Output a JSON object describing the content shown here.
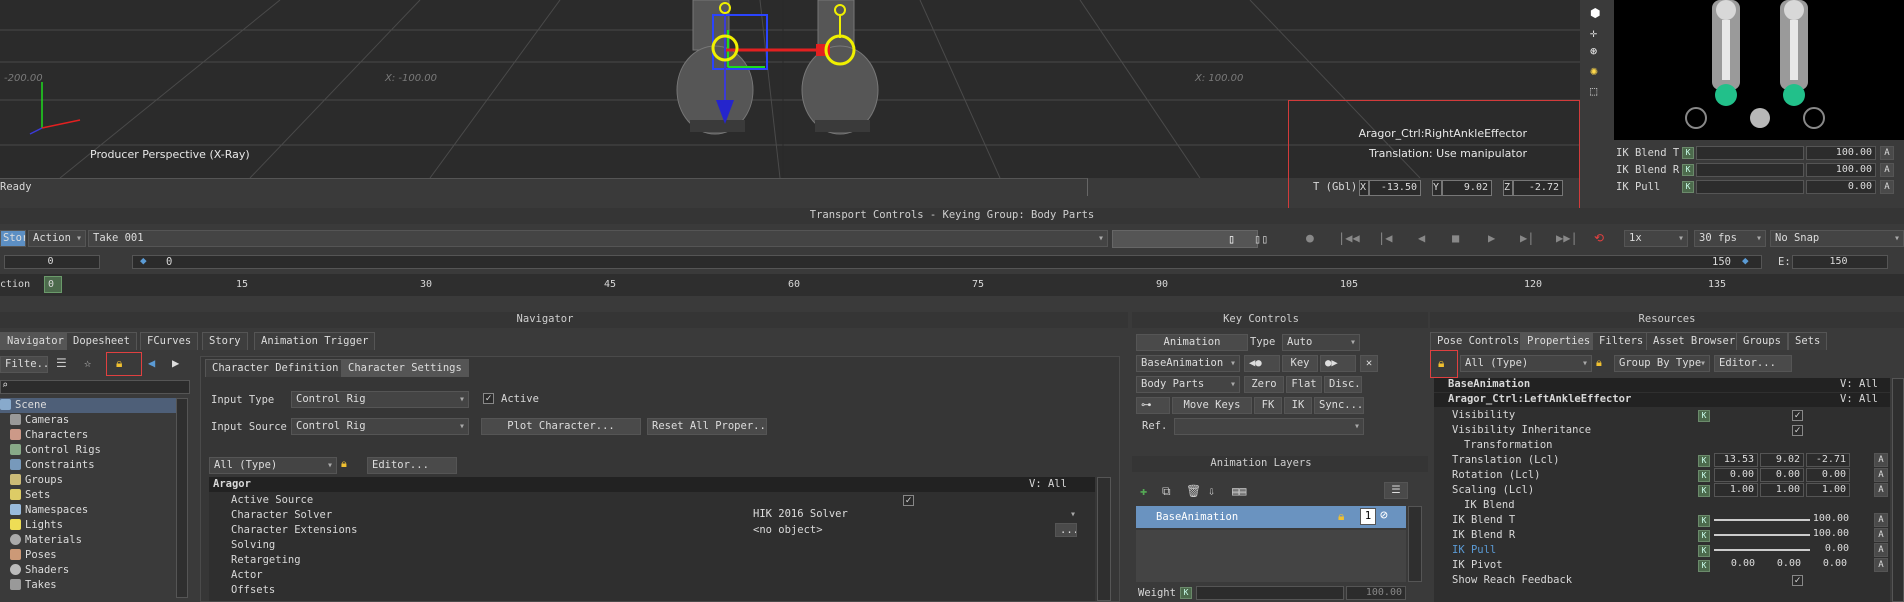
{
  "viewport": {
    "grid_labels": [
      "-200.00",
      "X: -100.00",
      "X: 100.00"
    ],
    "camera_label": "Producer Perspective (X-Ray)",
    "status": "Ready",
    "selection_name": "Aragor_Ctrl:RightAnkleEffector",
    "selection_mode": "Translation: Use manipulator",
    "coord_label": "T (Gbl)",
    "x_label": "X",
    "x_value": "-13.50",
    "y_label": "Y",
    "y_value": "9.02",
    "z_label": "Z",
    "z_value": "-2.72"
  },
  "ik_mini": {
    "rows": [
      {
        "label": "IK Blend T",
        "k": "K",
        "value": "100.00",
        "a": "A"
      },
      {
        "label": "IK Blend R",
        "k": "K",
        "value": "100.00",
        "a": "A"
      },
      {
        "label": "IK Pull",
        "k": "K",
        "value": "0.00",
        "a": "A"
      }
    ]
  },
  "transport": {
    "title": "Transport Controls  -  Keying Group: Body Parts",
    "story_btn": "Story",
    "action_combo": "Action",
    "take_combo": "Take 001",
    "speed": "1x",
    "fps": "30 fps",
    "snap": "No Snap",
    "start_frame": "0",
    "cur_frame": "0",
    "end_frame": "150",
    "end_label": "E:",
    "end_value": "150",
    "ruler_prefix": "ction",
    "ruler_marks": [
      "0",
      "15",
      "30",
      "45",
      "60",
      "75",
      "90",
      "105",
      "120",
      "135"
    ]
  },
  "navigator": {
    "title": "Navigator",
    "tabs": [
      "Navigator",
      "Dopesheet",
      "FCurves",
      "Story",
      "Animation Trigger"
    ],
    "filter_label": "Filte...",
    "tree": [
      "Scene",
      "Cameras",
      "Characters",
      "Control Rigs",
      "Constraints",
      "Groups",
      "Sets",
      "Namespaces",
      "Lights",
      "Materials",
      "Poses",
      "Shaders",
      "Takes"
    ],
    "char_tabs": [
      "Character Definition",
      "Character Settings"
    ],
    "input_type_label": "Input Type",
    "input_type_value": "Control Rig",
    "active_label": "Active",
    "input_source_label": "Input Source",
    "input_source_value": "Control Rig",
    "plot_btn": "Plot Character...",
    "reset_btn": "Reset All Proper...",
    "type_filter": "All (Type)",
    "editor_btn": "Editor...",
    "prop_header": "Aragor",
    "prop_header_v": "V: All",
    "props": [
      {
        "label": "Active Source",
        "value": ""
      },
      {
        "label": "Character Solver",
        "value": "HIK 2016 Solver"
      },
      {
        "label": "Character Extensions",
        "value": "<no object>"
      },
      {
        "label": "Solving",
        "value": ""
      },
      {
        "label": "Retargeting",
        "value": ""
      },
      {
        "label": "Actor",
        "value": ""
      },
      {
        "label": "Offsets",
        "value": ""
      }
    ]
  },
  "key_controls": {
    "title": "Key Controls",
    "animation_label": "Animation",
    "type_label": "Type",
    "type_value": "Auto",
    "layer_combo": "BaseAnimation",
    "key_btn": "Key",
    "group_combo": "Body Parts",
    "zero_btn": "Zero",
    "flat_btn": "Flat",
    "disc_btn": "Disc.",
    "move_keys_btn": "Move Keys",
    "fk_btn": "FK",
    "ik_btn": "IK",
    "sync_btn": "Sync...",
    "ref_label": "Ref."
  },
  "anim_layers": {
    "title": "Animation Layers",
    "layer_name": "BaseAnimation",
    "layer_num": "1",
    "weight_label": "Weight",
    "weight_k": "K",
    "weight_value": "100.00"
  },
  "resources": {
    "title": "Resources",
    "tabs": [
      "Pose Controls",
      "Properties",
      "Filters",
      "Asset Browser",
      "Groups",
      "Sets"
    ],
    "type_filter": "All (Type)",
    "group_by": "Group By Type",
    "editor_btn": "Editor...",
    "header1": "BaseAnimation",
    "header1_v": "V: All",
    "header2": "Aragor_Ctrl:LeftAnkleEffector",
    "header2_v": "V: All",
    "rows": [
      {
        "label": "Visibility",
        "k": "K",
        "v1": "",
        "v2": "",
        "v3": ""
      },
      {
        "label": "Visibility Inheritance",
        "k": "",
        "v1": "",
        "v2": "",
        "v3": ""
      },
      {
        "label": "Transformation",
        "k": "",
        "v1": "",
        "v2": "",
        "v3": ""
      },
      {
        "label": "Translation (Lcl)",
        "k": "K",
        "v1": "13.53",
        "v2": "9.02",
        "v3": "-2.71"
      },
      {
        "label": "Rotation (Lcl)",
        "k": "K",
        "v1": "0.00",
        "v2": "0.00",
        "v3": "0.00"
      },
      {
        "label": "Scaling (Lcl)",
        "k": "K",
        "v1": "1.00",
        "v2": "1.00",
        "v3": "1.00"
      },
      {
        "label": "IK Blend",
        "k": "",
        "v1": "",
        "v2": "",
        "v3": ""
      },
      {
        "label": "IK Blend T",
        "k": "K",
        "v1": "",
        "v2": "",
        "v3": "100.00"
      },
      {
        "label": "IK Blend R",
        "k": "K",
        "v1": "",
        "v2": "",
        "v3": "100.00"
      },
      {
        "label": "IK Pull",
        "k": "K",
        "v1": "",
        "v2": "",
        "v3": "0.00"
      },
      {
        "label": "IK Pivot",
        "k": "K",
        "v1": "0.00",
        "v2": "0.00",
        "v3": "0.00"
      },
      {
        "label": "Show Reach Feedback",
        "k": "",
        "v1": "",
        "v2": "",
        "v3": ""
      }
    ],
    "a_label": "A"
  },
  "colors": {
    "accent": "#5c8fc4",
    "redbox": "#e04040",
    "kgreen": "#4c6a4c",
    "ikpull": "#5b9bd5"
  }
}
